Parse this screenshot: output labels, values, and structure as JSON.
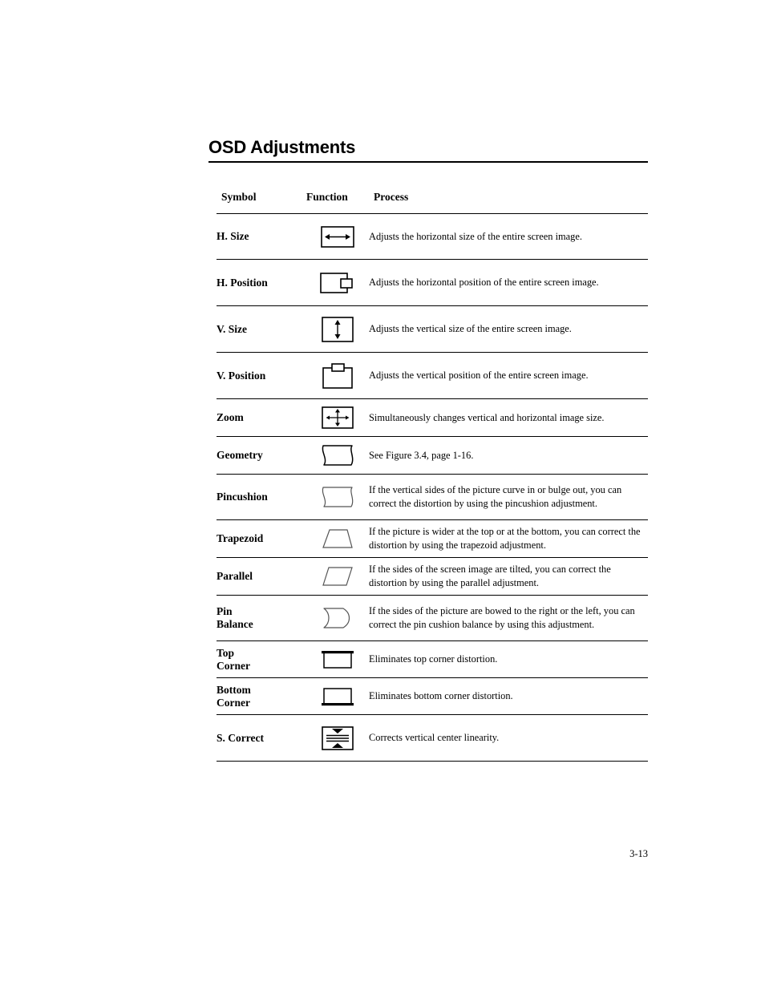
{
  "document": {
    "title": "OSD Adjustments",
    "page_number": "3-13"
  },
  "table": {
    "headers": {
      "symbol": "Symbol",
      "function": "Function",
      "process": "Process"
    },
    "rows": [
      {
        "symbol": "H. Size",
        "icon": "horizontal-size-icon",
        "process": "Adjusts the horizontal size of the entire screen image."
      },
      {
        "symbol": "H. Position",
        "icon": "horizontal-position-icon",
        "process": "Adjusts the horizontal position of the entire screen image."
      },
      {
        "symbol": "V. Size",
        "icon": "vertical-size-icon",
        "process": "Adjusts the vertical size of the entire screen image."
      },
      {
        "symbol": "V. Position",
        "icon": "vertical-position-icon",
        "process": "Adjusts the vertical position of the entire screen image."
      },
      {
        "symbol": "Zoom",
        "icon": "zoom-icon",
        "process": "Simultaneously changes vertical and horizontal image size."
      },
      {
        "symbol": "Geometry",
        "icon": "geometry-icon",
        "process": "See Figure 3.4, page 1-16."
      },
      {
        "symbol": "Pincushion",
        "icon": "pincushion-icon",
        "process": "If the vertical sides of the picture curve in or bulge out, you can correct the distortion by using the pincushion adjustment."
      },
      {
        "symbol": "Trapezoid",
        "icon": "trapezoid-icon",
        "process": "If the picture is wider at the top or at the bottom, you can correct the distortion by using the trapezoid adjustment."
      },
      {
        "symbol": "Parallel",
        "icon": "parallel-icon",
        "process": "If the sides of the screen image are tilted, you can correct the distortion by using the parallel adjustment."
      },
      {
        "symbol": "Pin\nBalance",
        "icon": "pin-balance-icon",
        "process": "If the sides of the picture are bowed to the right or the left, you can correct the pin cushion balance by using this adjustment."
      },
      {
        "symbol": "Top\nCorner",
        "icon": "top-corner-icon",
        "process": "Eliminates top corner distortion."
      },
      {
        "symbol": "Bottom\nCorner",
        "icon": "bottom-corner-icon",
        "process": "Eliminates bottom corner distortion."
      },
      {
        "symbol": "S. Correct",
        "icon": "s-correct-icon",
        "process": "Corrects vertical center linearity."
      }
    ]
  },
  "colors": {
    "text": "#000000",
    "background": "#ffffff",
    "rule": "#000000"
  }
}
